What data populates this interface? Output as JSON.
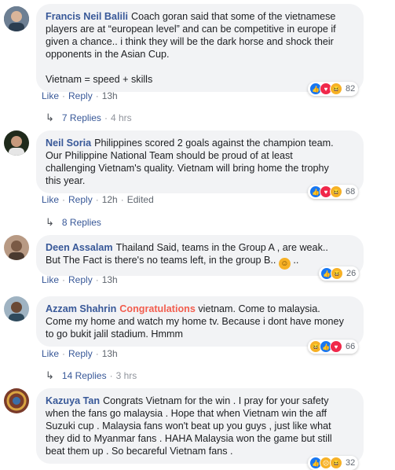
{
  "comments": [
    {
      "author": "Francis Neil Balili",
      "text_lines": [
        "Coach goran said that some of the vietnamese",
        "players are at “european level” and can be competitive in europe if",
        "given a chance.. i think they will be the dark horse and shock their",
        "opponents in the Asian Cup."
      ],
      "text2": "Vietnam = speed + skills",
      "like": "Like",
      "reply": "Reply",
      "time": "13h",
      "edited": "",
      "reaction_count": "82",
      "reactions": [
        "like",
        "love",
        "haha"
      ],
      "replies_label": "7 Replies",
      "replies_time": "4 hrs",
      "avatar_color": "#3b4a5c"
    },
    {
      "author": "Neil Soria",
      "text_lines": [
        "Philippines scored 2 goals against the champion team.",
        "Our Philippine National Team should be proud of at least",
        "challenging Vietnam's quality. Vietnam will bring home the trophy",
        "this year."
      ],
      "like": "Like",
      "reply": "Reply",
      "time": "12h",
      "edited": "Edited",
      "reaction_count": "68",
      "reactions": [
        "like",
        "love",
        "haha"
      ],
      "replies_label": "8 Replies",
      "replies_time": "",
      "avatar_color": "#2e3b2a"
    },
    {
      "author": "Deen Assalam",
      "text_lines": [
        "Thailand Said, teams in the Group A , are weak..",
        "But The Fact is there's no teams left, in the group B.."
      ],
      "emoji_after": "..",
      "like": "Like",
      "reply": "Reply",
      "time": "13h",
      "reaction_count": "26",
      "reactions": [
        "like",
        "haha"
      ],
      "avatar_color": "#8a6a55"
    },
    {
      "author": "Azzam Shahrin",
      "highlight": "Congratulations",
      "text_lines": [
        "vietnam. Come to malaysia.",
        "Come my home and watch my home tv. Because i dont have money",
        "to go bukit jalil stadium. Hmmm"
      ],
      "like": "Like",
      "reply": "Reply",
      "time": "13h",
      "reaction_count": "66",
      "reactions": [
        "haha",
        "like",
        "love"
      ],
      "replies_label": "14 Replies",
      "replies_time": "3 hrs",
      "avatar_color": "#4f6b7d"
    },
    {
      "author": "Kazuya Tan",
      "text_lines": [
        "Congrats Vietnam for the win . I pray for your safety",
        "when the fans go malaysia . Hope that when Vietnam win the aff",
        "Suzuki cup . Malaysia fans won't beat up you guys , just like what",
        "they did to Myanmar fans . HAHA Malaysia won the game but still",
        "beat them up . So becareful Vietnam fans ."
      ],
      "reaction_count": "32",
      "reactions": [
        "like",
        "sad",
        "haha"
      ],
      "avatar_color": "#7a3b2a"
    }
  ]
}
